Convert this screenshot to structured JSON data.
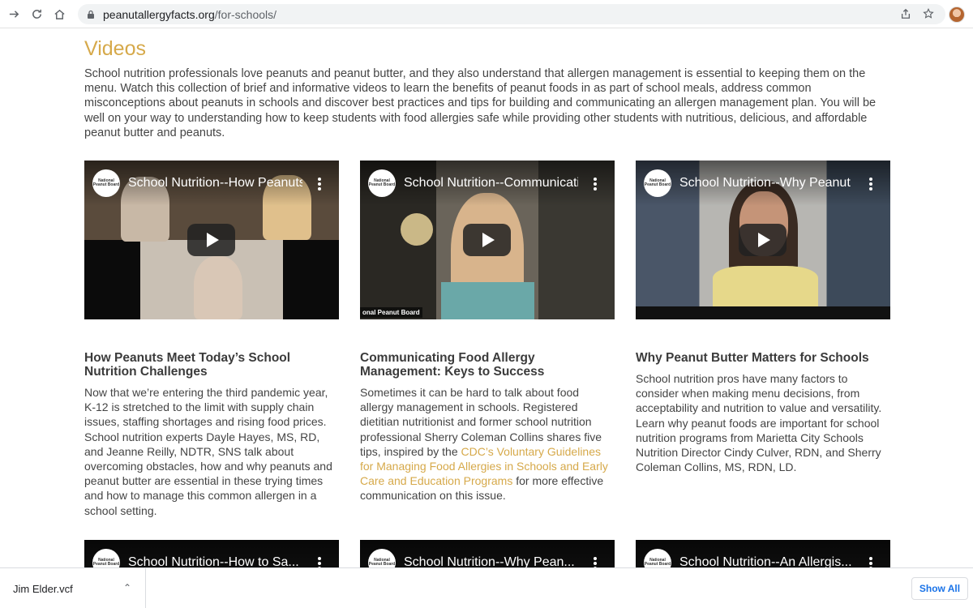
{
  "browser": {
    "url_domain": "peanutallergyfacts.org",
    "url_path": "/for-schools/"
  },
  "page": {
    "heading": "Videos",
    "intro": "School nutrition professionals love peanuts and peanut butter, and they also understand that allergen management is essential to keeping them on the menu. Watch this collection of brief and informative videos to learn the benefits of peanut foods in as part of school meals, address common misconceptions about peanuts in schools and discover best practices and tips for building and communicating an allergen management plan. You will be well on your way to understanding how to keep students with food allergies safe while providing other students with nutritious, delicious, and affordable peanut butter and peanuts."
  },
  "videos": [
    {
      "video_title": "School Nutrition--How Peanuts Meet Today's School Nutrition Challenges",
      "card_title": "How Peanuts Meet Today’s School Nutrition Challenges",
      "body": "Now that we’re entering the third pandemic year, K-12 is stretched to the limit with supply chain issues, staffing shortages and rising food prices. School nutrition experts Dayle Hayes, MS, RD, and Jeanne Reilly, NDTR, SNS talk about overcoming obstacles, how and why peanuts and peanut butter are essential in these trying times and how to manage this common allergen in a school setting."
    },
    {
      "video_title": "School Nutrition--Communicating Food Allergy Management",
      "card_title": "Communicating Food Allergy Management: Keys to Success",
      "body_before": "Sometimes it can be hard to talk about food allergy management in schools. Registered dietitian nutritionist and former school nutrition professional Sherry Coleman Collins shares five tips, inspired by the ",
      "link": "CDC’s Voluntary Guidelines for Managing Food Allergies in Schools and Early Care and Education Programs",
      "body_after": " for more effective communication on this issue.",
      "watermark": "onal Peanut Board"
    },
    {
      "video_title": "School Nutrition--Why Peanut Butter Matters for Schools",
      "card_title": "Why Peanut Butter Matters for Schools",
      "body": "School nutrition pros have many factors to consider when making menu decisions, from acceptability and nutrition to value and versatility. Learn why peanut foods are important for school nutrition programs from Marietta City Schools Nutrition Director Cindy Culver, RDN, and Sherry Coleman Collins, MS, RDN, LD."
    }
  ],
  "videos_row2": [
    {
      "video_title": "School Nutrition--How to Sa..."
    },
    {
      "video_title": "School Nutrition--Why Pean..."
    },
    {
      "video_title": "School Nutrition--An Allergis..."
    }
  ],
  "logo_text": "National Peanut Board",
  "download_bar": {
    "file_name": "Jim Elder.vcf",
    "show_all": "Show All"
  }
}
